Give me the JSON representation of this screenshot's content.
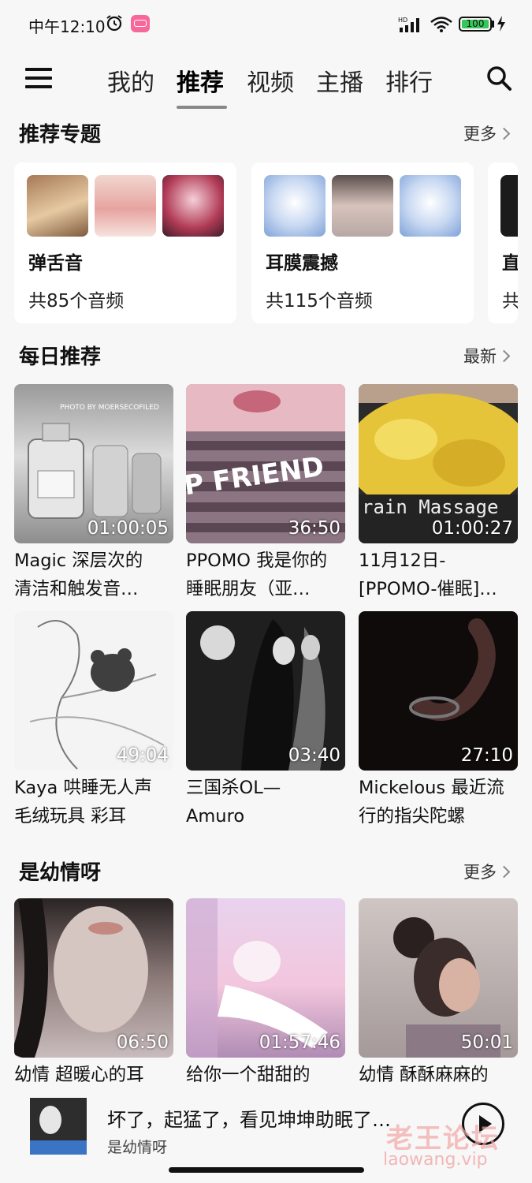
{
  "status": {
    "time": "中午12:10",
    "battery": "100",
    "battery_level": 1.0,
    "signal_label": "HD"
  },
  "nav": {
    "tabs": [
      {
        "label": "我的"
      },
      {
        "label": "推荐",
        "active": true
      },
      {
        "label": "视频"
      },
      {
        "label": "主播"
      },
      {
        "label": "排行"
      }
    ]
  },
  "topics": {
    "title": "推荐专题",
    "more": "更多",
    "cards": [
      {
        "name": "弹舌音",
        "count": "共85个音频"
      },
      {
        "name": "耳膜震撼",
        "count": "共115个音频"
      },
      {
        "name": "直",
        "count": "共"
      }
    ]
  },
  "daily": {
    "title": "每日推荐",
    "more": "最新",
    "items": [
      {
        "title": "Magic 深层次的\n清洁和触发音…",
        "duration": "01:00:05",
        "thumb_text": "PHOTO BY MOERSECOFILED"
      },
      {
        "title": "PPOMO 我是你的\n睡眠朋友（亚…",
        "duration": "36:50",
        "thumb_text": "P FRIEND"
      },
      {
        "title": "11月12日-\n[PPOMO-催眠]…",
        "duration": "01:00:27",
        "thumb_text": "rain Massage"
      },
      {
        "title": "Kaya 哄睡无人声\n毛绒玩具 彩耳",
        "duration": "49:04"
      },
      {
        "title": "三国杀OL—\nAmuro",
        "duration": "03:40"
      },
      {
        "title": "Mickelous 最近流\n行的指尖陀螺",
        "duration": "27:10"
      }
    ]
  },
  "youqing": {
    "title": "是幼情呀",
    "more": "更多",
    "items": [
      {
        "title": "幼情 超暖心的耳",
        "duration": "06:50"
      },
      {
        "title": "给你一个甜甜的",
        "duration": "01:57:46"
      },
      {
        "title": "幼情 酥酥麻麻的",
        "duration": "50:01"
      }
    ]
  },
  "player": {
    "title": "坏了，起猛了，看见坤坤助眠了…",
    "subtitle": "是幼情呀"
  },
  "watermark": {
    "cn": "老王论坛",
    "en": "laowang.vip"
  },
  "colors": {
    "accent_pink": "#f7679a",
    "battery_green": "#35c759"
  }
}
